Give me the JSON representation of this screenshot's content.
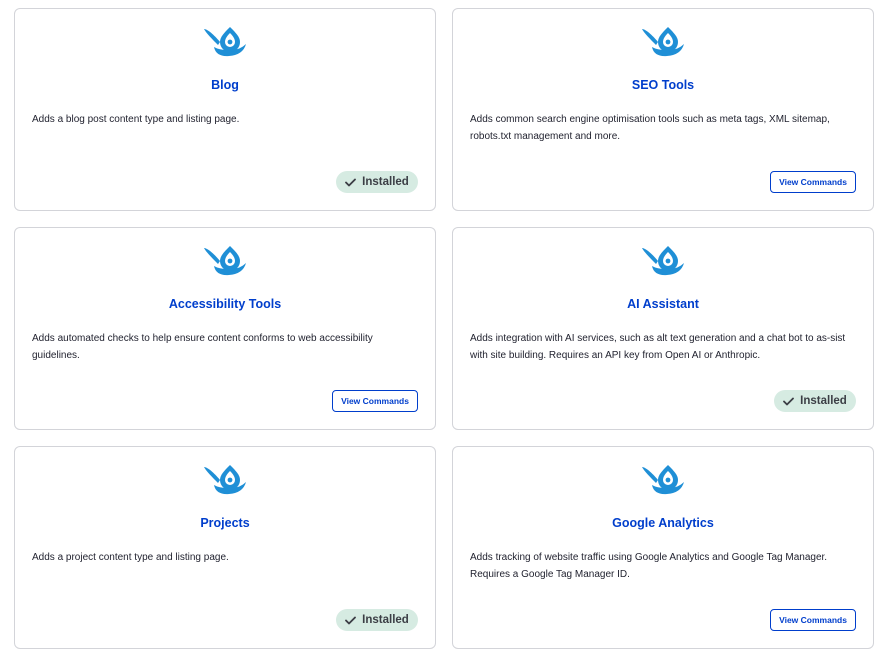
{
  "colors": {
    "accent": "#003ecc",
    "icon": "#1f8fd6",
    "installed_bg": "#d6ebe2"
  },
  "cards": [
    {
      "icon": "drupal-spoon-icon",
      "title": "Blog",
      "description": "Adds a blog post content type and listing page.",
      "status": "Installed"
    },
    {
      "icon": "drupal-spoon-icon",
      "title": "SEO Tools",
      "description": "Adds common search engine optimisation tools such as meta tags, XML sitemap, robots.txt management and more.",
      "action": "View Commands"
    },
    {
      "icon": "drupal-spoon-icon",
      "title": "Accessibility Tools",
      "description": "Adds automated checks to help ensure content conforms to web accessibility guidelines.",
      "action": "View Commands"
    },
    {
      "icon": "drupal-spoon-icon",
      "title": "AI Assistant",
      "description": "Adds integration with AI services, such as alt text generation and a chat bot to as-sist with site building. Requires an API key from Open AI or Anthropic.",
      "status": "Installed"
    },
    {
      "icon": "drupal-spoon-icon",
      "title": "Projects",
      "description": "Adds a project content type and listing page.",
      "status": "Installed"
    },
    {
      "icon": "drupal-spoon-icon",
      "title": "Google Analytics",
      "description": "Adds tracking of website traffic using Google Analytics and Google Tag Manager. Requires a Google Tag Manager ID.",
      "action": "View Commands"
    }
  ]
}
